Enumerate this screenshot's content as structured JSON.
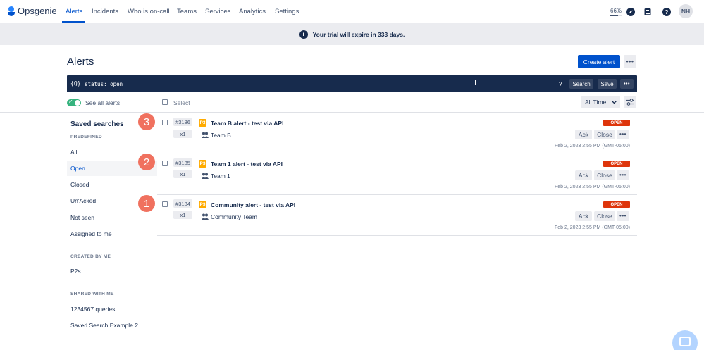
{
  "app": {
    "name": "Opsgenie",
    "brand_color": "#0052cc"
  },
  "nav": {
    "items": [
      {
        "label": "Alerts",
        "active": true
      },
      {
        "label": "Incidents"
      },
      {
        "label": "Who is on-call"
      },
      {
        "label": "Teams"
      },
      {
        "label": "Services"
      },
      {
        "label": "Analytics"
      },
      {
        "label": "Settings"
      }
    ],
    "zoom": "66%",
    "zoom_level": 0.66,
    "icons": [
      "compass-icon",
      "book-icon",
      "help-icon"
    ],
    "avatar": "NH"
  },
  "banner": {
    "text": "Your trial will expire in 333 days."
  },
  "page": {
    "title": "Alerts",
    "create_label": "Create alert"
  },
  "query": {
    "prefix": "{Q}",
    "text": "status: open",
    "help": "?",
    "search_label": "Search",
    "save_label": "Save"
  },
  "filters": {
    "see_all_label": "See all alerts",
    "select_label": "Select",
    "time_range": "All Time"
  },
  "sidebar": {
    "heading": "Saved searches",
    "groups": [
      {
        "title": "PREDEFINED",
        "items": [
          "All",
          "Open",
          "Closed",
          "Un'Acked",
          "Not seen",
          "Assigned to me"
        ]
      },
      {
        "title": "CREATED BY ME",
        "items": [
          "P2s"
        ]
      },
      {
        "title": "SHARED WITH ME",
        "items": [
          "1234567 queries",
          "Saved Search Example 2"
        ]
      }
    ],
    "selected": "Open"
  },
  "badges": [
    "3",
    "2",
    "1"
  ],
  "alerts": [
    {
      "id": "#3186",
      "count": "x1",
      "priority": "P3",
      "title": "Team B alert - test via API",
      "team": "Team B",
      "status": "OPEN",
      "ack": "Ack",
      "close": "Close",
      "date": "Feb 2, 2023 2:55 PM (GMT-05:00)"
    },
    {
      "id": "#3185",
      "count": "x1",
      "priority": "P3",
      "title": "Team 1 alert - test via API",
      "team": "Team 1",
      "status": "OPEN",
      "ack": "Ack",
      "close": "Close",
      "date": "Feb 2, 2023 2:55 PM (GMT-05:00)"
    },
    {
      "id": "#3184",
      "count": "x1",
      "priority": "P3",
      "title": "Community alert - test via API",
      "team": "Community Team",
      "status": "OPEN",
      "ack": "Ack",
      "close": "Close",
      "date": "Feb 2, 2023 2:55 PM (GMT-05:00)"
    }
  ],
  "colors": {
    "status_open": "#de350b",
    "priority_p3": "#ffab00",
    "badge": "#f0715f",
    "query_bg": "#172b4d"
  }
}
